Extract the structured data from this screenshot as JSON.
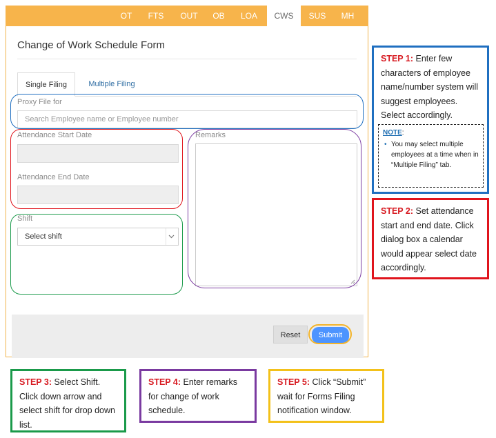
{
  "nav": {
    "tabs": [
      {
        "label": "OT"
      },
      {
        "label": "FTS"
      },
      {
        "label": "OUT"
      },
      {
        "label": "OB"
      },
      {
        "label": "LOA"
      },
      {
        "label": "CWS"
      },
      {
        "label": "SUS"
      },
      {
        "label": "MH"
      }
    ],
    "active_tab": "CWS"
  },
  "form": {
    "title": "Change of Work Schedule Form",
    "tabs": {
      "single": "Single Filing",
      "multiple": "Multiple Filing"
    },
    "proxy_label": "Proxy File for",
    "proxy_placeholder": "Search Employee name or Employee number",
    "start_date_label": "Attendance Start Date",
    "end_date_label": "Attendance End Date",
    "shift_label": "Shift",
    "shift_value": "Select shift",
    "remarks_label": "Remarks",
    "reset_label": "Reset",
    "submit_label": "Submit"
  },
  "callouts": {
    "step1": {
      "step": "STEP 1:",
      "text": "Enter few characters of employee name/number system will suggest employees. Select accordingly."
    },
    "note": {
      "title": "NOTE",
      "colon": ":",
      "item": "You may select multiple employees at a time when in “Multiple Filing” tab."
    },
    "step2": {
      "step": "STEP 2:",
      "text": "Set attendance start and end date. Click dialog box a calendar would appear select date accordingly."
    },
    "step3": {
      "step": "STEP 3:",
      "text": "Select Shift. Click down arrow and select shift for drop down list."
    },
    "step4": {
      "step": "STEP 4:",
      "text": "Enter remarks for change of work schedule."
    },
    "step5": {
      "step": "STEP 5:",
      "text": "Click “Submit” wait for Forms Filing notification window."
    }
  },
  "colors": {
    "topbar": "#f7b44b",
    "step1_border": "#1f6fc0",
    "step2_border": "#e0141c",
    "step3_border": "#1a9a4a",
    "step4_border": "#7a3aa0",
    "step5_border": "#f3c11a",
    "submit_button": "#4d94ff"
  }
}
